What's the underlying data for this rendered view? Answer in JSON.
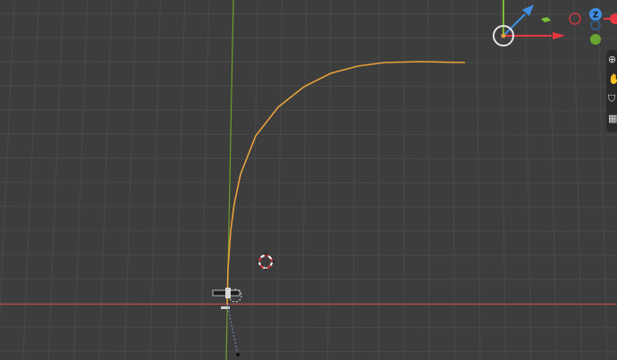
{
  "viewport": {
    "background": "#3d3d3d",
    "grid_color": "#4a4a4a",
    "x_axis_color": "#bf4444",
    "y_axis_color": "#6f9e2c"
  },
  "curve": {
    "color": "#e8a23c"
  },
  "nav_gizmo": {
    "z_label": "Z",
    "x_color": "#e8383f",
    "y_color": "#7bbd38",
    "z_color": "#3e8ee0"
  },
  "side_tools": [
    {
      "name": "zoom-icon",
      "glyph": "⊕"
    },
    {
      "name": "hand-icon",
      "glyph": "✋"
    },
    {
      "name": "camera-icon",
      "glyph": "⛉"
    },
    {
      "name": "grid-icon",
      "glyph": "▦"
    }
  ]
}
